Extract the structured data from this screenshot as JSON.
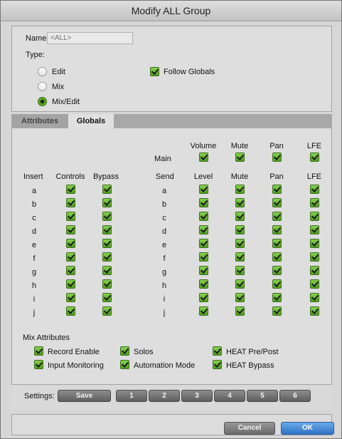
{
  "window": {
    "title": "Modify ALL Group"
  },
  "top": {
    "name_label": "Name:",
    "name_placeholder": "<ALL>",
    "type_label": "Type:",
    "type_options": [
      {
        "label": "Edit",
        "selected": false
      },
      {
        "label": "Mix",
        "selected": false
      },
      {
        "label": "Mix/Edit",
        "selected": true
      }
    ],
    "follow_globals": {
      "label": "Follow Globals",
      "checked": true
    }
  },
  "tabs": [
    {
      "label": "Attributes",
      "active": false
    },
    {
      "label": "Globals",
      "active": true
    }
  ],
  "globals": {
    "main_headers": [
      "Volume",
      "Mute",
      "Pan",
      "LFE"
    ],
    "main_label": "Main",
    "insert_headers": [
      "Insert",
      "Controls",
      "Bypass"
    ],
    "send_headers": [
      "Send",
      "Level",
      "Mute",
      "Pan",
      "LFE"
    ],
    "rows": [
      "a",
      "b",
      "c",
      "d",
      "e",
      "f",
      "g",
      "h",
      "i",
      "j"
    ],
    "checkmark_color": "#5db12b"
  },
  "mix_attributes": {
    "title": "Mix Attributes",
    "items": [
      {
        "label": "Record Enable",
        "checked": true
      },
      {
        "label": "Solos",
        "checked": true
      },
      {
        "label": "HEAT Pre/Post",
        "checked": true
      },
      {
        "label": "Input Monitoring",
        "checked": true
      },
      {
        "label": "Automation Mode",
        "checked": true
      },
      {
        "label": "HEAT Bypass",
        "checked": true
      }
    ]
  },
  "settings": {
    "label": "Settings:",
    "save_label": "Save",
    "presets": [
      "1",
      "2",
      "3",
      "4",
      "5",
      "6"
    ]
  },
  "dialog": {
    "cancel_label": "Cancel",
    "ok_label": "OK",
    "ok_color": "#3b82d6"
  }
}
